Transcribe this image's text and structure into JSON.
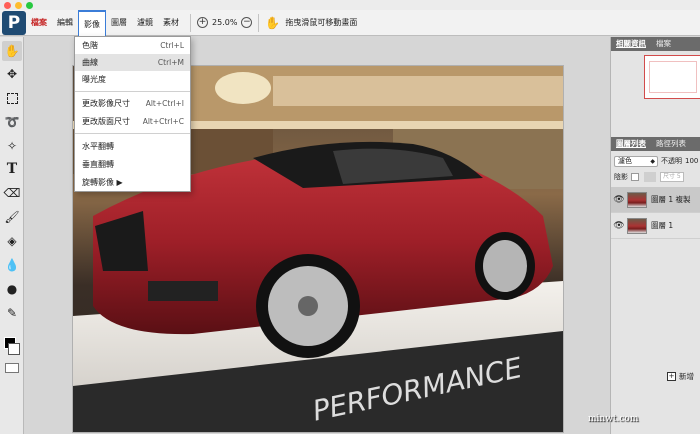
{
  "colors": {
    "accent": "#3b7dd8",
    "brand": "#1f4b73",
    "active_menu_red": "#c62828",
    "panel_tab": "#6b6b6b"
  },
  "logo": {
    "letter": "P"
  },
  "menubar": {
    "items": [
      {
        "label": "檔案"
      },
      {
        "label": "編輯"
      },
      {
        "label": "影像"
      },
      {
        "label": "圖層"
      },
      {
        "label": "濾鏡"
      },
      {
        "label": "素材"
      }
    ],
    "zoom": {
      "in": "+",
      "value": "25.0%",
      "out": "−"
    },
    "hint": "拖曳滑鼠可移動畫面"
  },
  "image_menu": {
    "items": [
      {
        "label": "色階",
        "shortcut": "Ctrl+L"
      },
      {
        "label": "曲線",
        "shortcut": "Ctrl+M"
      },
      {
        "label": "曝光度",
        "shortcut": ""
      },
      {
        "label": "更改影像尺寸",
        "shortcut": "Alt+Ctrl+I"
      },
      {
        "label": "更改版面尺寸",
        "shortcut": "Alt+Ctrl+C"
      },
      {
        "label": "水平翻轉",
        "shortcut": ""
      },
      {
        "label": "垂直翻轉",
        "shortcut": ""
      },
      {
        "label": "旋轉影像 ▶",
        "shortcut": ""
      }
    ]
  },
  "right_panel": {
    "top_tabs": [
      "相關資訊",
      "檔案"
    ],
    "layer_tabs": [
      "圖層列表",
      "路徑列表"
    ],
    "blend_mode": "濾色",
    "opacity_label": "不透明",
    "opacity_value": "100",
    "lock_label": "陰影",
    "size_placeholder": "尺寸 5",
    "layers": [
      {
        "name": "圖層 1 複製"
      },
      {
        "name": "圖層 1"
      }
    ],
    "new_label": "新增"
  },
  "photo": {
    "banner_text": "PERFORMANCE"
  },
  "watermark": "minwt.com"
}
